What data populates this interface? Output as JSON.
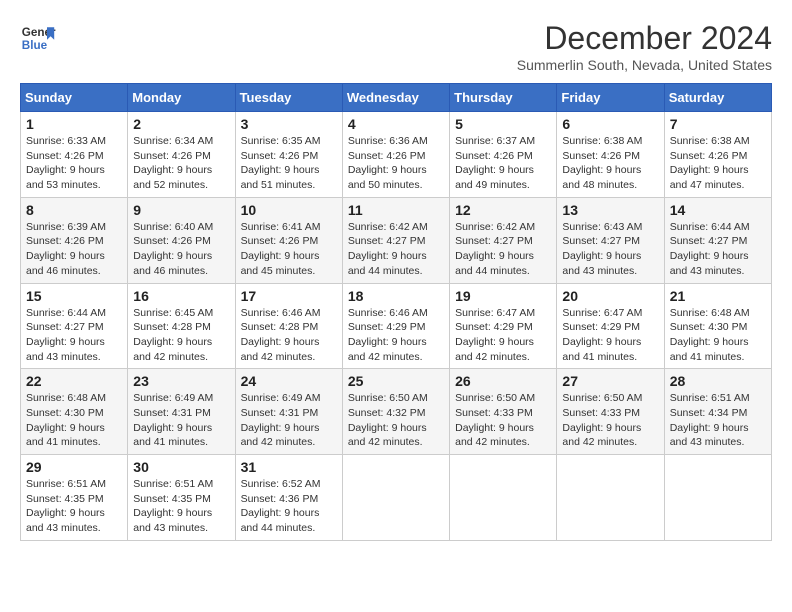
{
  "header": {
    "logo_line1": "General",
    "logo_line2": "Blue",
    "month": "December 2024",
    "location": "Summerlin South, Nevada, United States"
  },
  "days_of_week": [
    "Sunday",
    "Monday",
    "Tuesday",
    "Wednesday",
    "Thursday",
    "Friday",
    "Saturday"
  ],
  "weeks": [
    [
      {
        "day": 1,
        "sunrise": "6:33 AM",
        "sunset": "4:26 PM",
        "daylight": "9 hours and 53 minutes."
      },
      {
        "day": 2,
        "sunrise": "6:34 AM",
        "sunset": "4:26 PM",
        "daylight": "9 hours and 52 minutes."
      },
      {
        "day": 3,
        "sunrise": "6:35 AM",
        "sunset": "4:26 PM",
        "daylight": "9 hours and 51 minutes."
      },
      {
        "day": 4,
        "sunrise": "6:36 AM",
        "sunset": "4:26 PM",
        "daylight": "9 hours and 50 minutes."
      },
      {
        "day": 5,
        "sunrise": "6:37 AM",
        "sunset": "4:26 PM",
        "daylight": "9 hours and 49 minutes."
      },
      {
        "day": 6,
        "sunrise": "6:38 AM",
        "sunset": "4:26 PM",
        "daylight": "9 hours and 48 minutes."
      },
      {
        "day": 7,
        "sunrise": "6:38 AM",
        "sunset": "4:26 PM",
        "daylight": "9 hours and 47 minutes."
      }
    ],
    [
      {
        "day": 8,
        "sunrise": "6:39 AM",
        "sunset": "4:26 PM",
        "daylight": "9 hours and 46 minutes."
      },
      {
        "day": 9,
        "sunrise": "6:40 AM",
        "sunset": "4:26 PM",
        "daylight": "9 hours and 46 minutes."
      },
      {
        "day": 10,
        "sunrise": "6:41 AM",
        "sunset": "4:26 PM",
        "daylight": "9 hours and 45 minutes."
      },
      {
        "day": 11,
        "sunrise": "6:42 AM",
        "sunset": "4:27 PM",
        "daylight": "9 hours and 44 minutes."
      },
      {
        "day": 12,
        "sunrise": "6:42 AM",
        "sunset": "4:27 PM",
        "daylight": "9 hours and 44 minutes."
      },
      {
        "day": 13,
        "sunrise": "6:43 AM",
        "sunset": "4:27 PM",
        "daylight": "9 hours and 43 minutes."
      },
      {
        "day": 14,
        "sunrise": "6:44 AM",
        "sunset": "4:27 PM",
        "daylight": "9 hours and 43 minutes."
      }
    ],
    [
      {
        "day": 15,
        "sunrise": "6:44 AM",
        "sunset": "4:27 PM",
        "daylight": "9 hours and 43 minutes."
      },
      {
        "day": 16,
        "sunrise": "6:45 AM",
        "sunset": "4:28 PM",
        "daylight": "9 hours and 42 minutes."
      },
      {
        "day": 17,
        "sunrise": "6:46 AM",
        "sunset": "4:28 PM",
        "daylight": "9 hours and 42 minutes."
      },
      {
        "day": 18,
        "sunrise": "6:46 AM",
        "sunset": "4:29 PM",
        "daylight": "9 hours and 42 minutes."
      },
      {
        "day": 19,
        "sunrise": "6:47 AM",
        "sunset": "4:29 PM",
        "daylight": "9 hours and 42 minutes."
      },
      {
        "day": 20,
        "sunrise": "6:47 AM",
        "sunset": "4:29 PM",
        "daylight": "9 hours and 41 minutes."
      },
      {
        "day": 21,
        "sunrise": "6:48 AM",
        "sunset": "4:30 PM",
        "daylight": "9 hours and 41 minutes."
      }
    ],
    [
      {
        "day": 22,
        "sunrise": "6:48 AM",
        "sunset": "4:30 PM",
        "daylight": "9 hours and 41 minutes."
      },
      {
        "day": 23,
        "sunrise": "6:49 AM",
        "sunset": "4:31 PM",
        "daylight": "9 hours and 41 minutes."
      },
      {
        "day": 24,
        "sunrise": "6:49 AM",
        "sunset": "4:31 PM",
        "daylight": "9 hours and 42 minutes."
      },
      {
        "day": 25,
        "sunrise": "6:50 AM",
        "sunset": "4:32 PM",
        "daylight": "9 hours and 42 minutes."
      },
      {
        "day": 26,
        "sunrise": "6:50 AM",
        "sunset": "4:33 PM",
        "daylight": "9 hours and 42 minutes."
      },
      {
        "day": 27,
        "sunrise": "6:50 AM",
        "sunset": "4:33 PM",
        "daylight": "9 hours and 42 minutes."
      },
      {
        "day": 28,
        "sunrise": "6:51 AM",
        "sunset": "4:34 PM",
        "daylight": "9 hours and 43 minutes."
      }
    ],
    [
      {
        "day": 29,
        "sunrise": "6:51 AM",
        "sunset": "4:35 PM",
        "daylight": "9 hours and 43 minutes."
      },
      {
        "day": 30,
        "sunrise": "6:51 AM",
        "sunset": "4:35 PM",
        "daylight": "9 hours and 43 minutes."
      },
      {
        "day": 31,
        "sunrise": "6:52 AM",
        "sunset": "4:36 PM",
        "daylight": "9 hours and 44 minutes."
      },
      null,
      null,
      null,
      null
    ]
  ]
}
